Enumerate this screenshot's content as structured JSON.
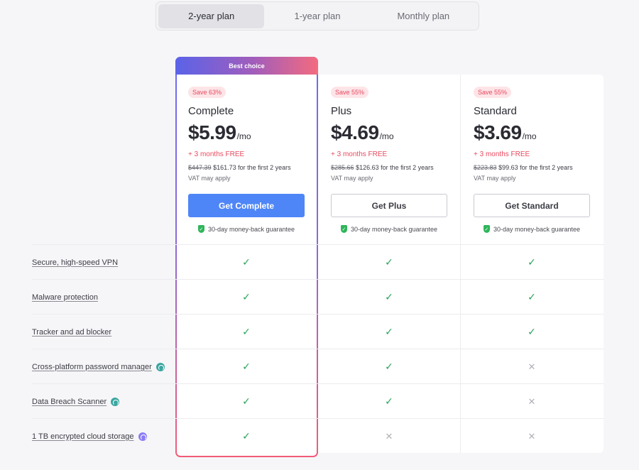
{
  "switcher": {
    "tabs": [
      "2-year plan",
      "1-year plan",
      "Monthly plan"
    ],
    "active": "2-year plan"
  },
  "featured_badge": "Best choice",
  "plans": [
    {
      "save": "Save 63%",
      "name": "Complete",
      "price": "$5.99",
      "per": "/mo",
      "free": "+ 3 months FREE",
      "old_price": "$447.39",
      "billing": "$161.73 for the first 2 years",
      "vat": "VAT may apply",
      "cta": "Get Complete",
      "guarantee": "30-day money-back guarantee"
    },
    {
      "save": "Save 55%",
      "name": "Plus",
      "price": "$4.69",
      "per": "/mo",
      "free": "+ 3 months FREE",
      "old_price": "$285.66",
      "billing": "$126.63 for the first 2 years",
      "vat": "VAT may apply",
      "cta": "Get Plus",
      "guarantee": "30-day money-back guarantee"
    },
    {
      "save": "Save 55%",
      "name": "Standard",
      "price": "$3.69",
      "per": "/mo",
      "free": "+ 3 months FREE",
      "old_price": "$223.83",
      "billing": "$99.63 for the first 2 years",
      "vat": "VAT may apply",
      "cta": "Get Standard",
      "guarantee": "30-day money-back guarantee"
    }
  ],
  "features": [
    {
      "label": "Secure, high-speed VPN",
      "icon": "",
      "included": [
        true,
        true,
        true
      ]
    },
    {
      "label": "Malware protection",
      "icon": "",
      "included": [
        true,
        true,
        true
      ]
    },
    {
      "label": "Tracker and ad blocker",
      "icon": "",
      "included": [
        true,
        true,
        true
      ]
    },
    {
      "label": "Cross-platform password manager",
      "icon": "password-manager-icon",
      "included": [
        true,
        true,
        false
      ]
    },
    {
      "label": "Data Breach Scanner",
      "icon": "breach-scanner-icon",
      "included": [
        true,
        true,
        false
      ]
    },
    {
      "label": "1 TB encrypted cloud storage",
      "icon": "cloud-storage-icon",
      "included": [
        true,
        false,
        false
      ]
    }
  ],
  "colors": {
    "accent_blue": "#4f86f7",
    "accent_red": "#e84a5f",
    "check_green": "#29a35a"
  }
}
